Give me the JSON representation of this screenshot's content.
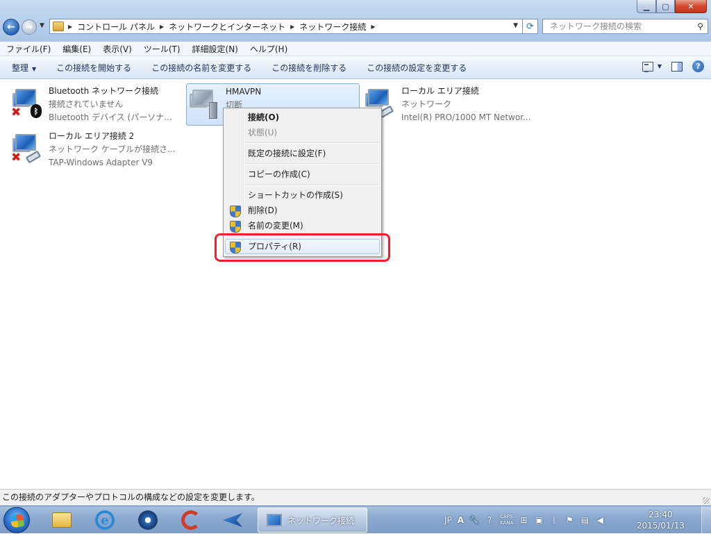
{
  "address": {
    "crumbs": [
      "コントロール パネル",
      "ネットワークとインターネット",
      "ネットワーク接続"
    ]
  },
  "search": {
    "placeholder": "ネットワーク接続の検索"
  },
  "menubar": [
    "ファイル(F)",
    "編集(E)",
    "表示(V)",
    "ツール(T)",
    "詳細設定(N)",
    "ヘルプ(H)"
  ],
  "commandbar": {
    "organize": "整理",
    "start_connection": "この接続を開始する",
    "rename_connection": "この接続の名前を変更する",
    "delete_connection": "この接続を削除する",
    "change_settings": "この接続の設定を変更する"
  },
  "connections": [
    {
      "name": "Bluetooth ネットワーク接続",
      "status": "接続されていません",
      "device": "Bluetooth デバイス (パーソナ..."
    },
    {
      "name": "HMAVPN",
      "status": "切断",
      "device": ""
    },
    {
      "name": "ローカル エリア接続",
      "status": "ネットワーク",
      "device": "Intel(R) PRO/1000 MT Networ..."
    },
    {
      "name": "ローカル エリア接続 2",
      "status": "ネットワーク ケーブルが接続さ...",
      "device": "TAP-Windows Adapter V9"
    }
  ],
  "context_menu": {
    "connect": "接続(O)",
    "status": "状態(U)",
    "set_default": "既定の接続に設定(F)",
    "copy": "コピーの作成(C)",
    "shortcut": "ショートカットの作成(S)",
    "delete": "削除(D)",
    "rename": "名前の変更(M)",
    "properties": "プロパティ(R)"
  },
  "statusbar": {
    "text": "この接続のアダプターやプロトコルの構成などの設定を変更します。"
  },
  "taskbar": {
    "active_task": "ネットワーク接続",
    "tray": {
      "lang": "JP",
      "ime": "A",
      "caps": "CAPS",
      "kana": "KANA"
    },
    "time": "23:40",
    "date": "2015/01/13"
  },
  "colors": {
    "highlight_box": "#e8242a",
    "selection_blue": "#cfe3fb"
  }
}
